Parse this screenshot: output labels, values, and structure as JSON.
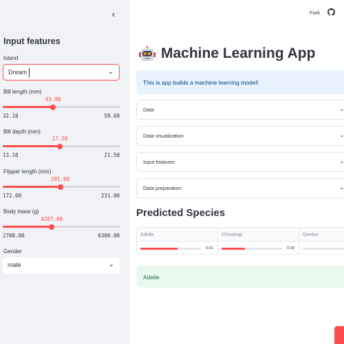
{
  "sidebar": {
    "collapse_icon": "chevron-left-icon",
    "heading": "Input features",
    "island": {
      "label": "Island",
      "value": "Dream"
    },
    "sliders": [
      {
        "label": "Bill length (mm)",
        "value": "43.90",
        "min": "32.10",
        "max": "59.60",
        "fraction": 0.429
      },
      {
        "label": "Bill depth (mm)",
        "value": "17.20",
        "min": "13.10",
        "max": "21.50",
        "fraction": 0.488
      },
      {
        "label": "Flipper length (mm)",
        "value": "201.00",
        "min": "172.00",
        "max": "231.00",
        "fraction": 0.492
      },
      {
        "label": "Body mass (g)",
        "value": "4207.00",
        "min": "2700.00",
        "max": "6300.00",
        "fraction": 0.419
      }
    ],
    "gender": {
      "label": "Gender",
      "value": "male"
    }
  },
  "toolbar": {
    "fork_label": "Fork",
    "github_icon": "github-icon"
  },
  "main": {
    "title_icon": "robot-icon",
    "title": "Machine Learning App",
    "info": "This is app builds a machine learning model!",
    "expanders": [
      "Data",
      "Data visualization",
      "Input features",
      "Data preparation"
    ],
    "subheader": "Predicted Species",
    "prediction_table": {
      "columns": [
        "Adelie",
        "Chinstrap",
        "Gentoo"
      ],
      "probabilities": [
        {
          "label": "0.61",
          "value": 0.61
        },
        {
          "label": "0.39",
          "value": 0.39
        },
        {
          "label": "",
          "value": 0
        }
      ]
    },
    "result": "Adelie"
  },
  "colors": {
    "accent": "#ff4b4b",
    "sidebar_bg": "#f0f2f6",
    "info_bg": "#e8f2fc",
    "success_bg": "#e9f9ef"
  }
}
